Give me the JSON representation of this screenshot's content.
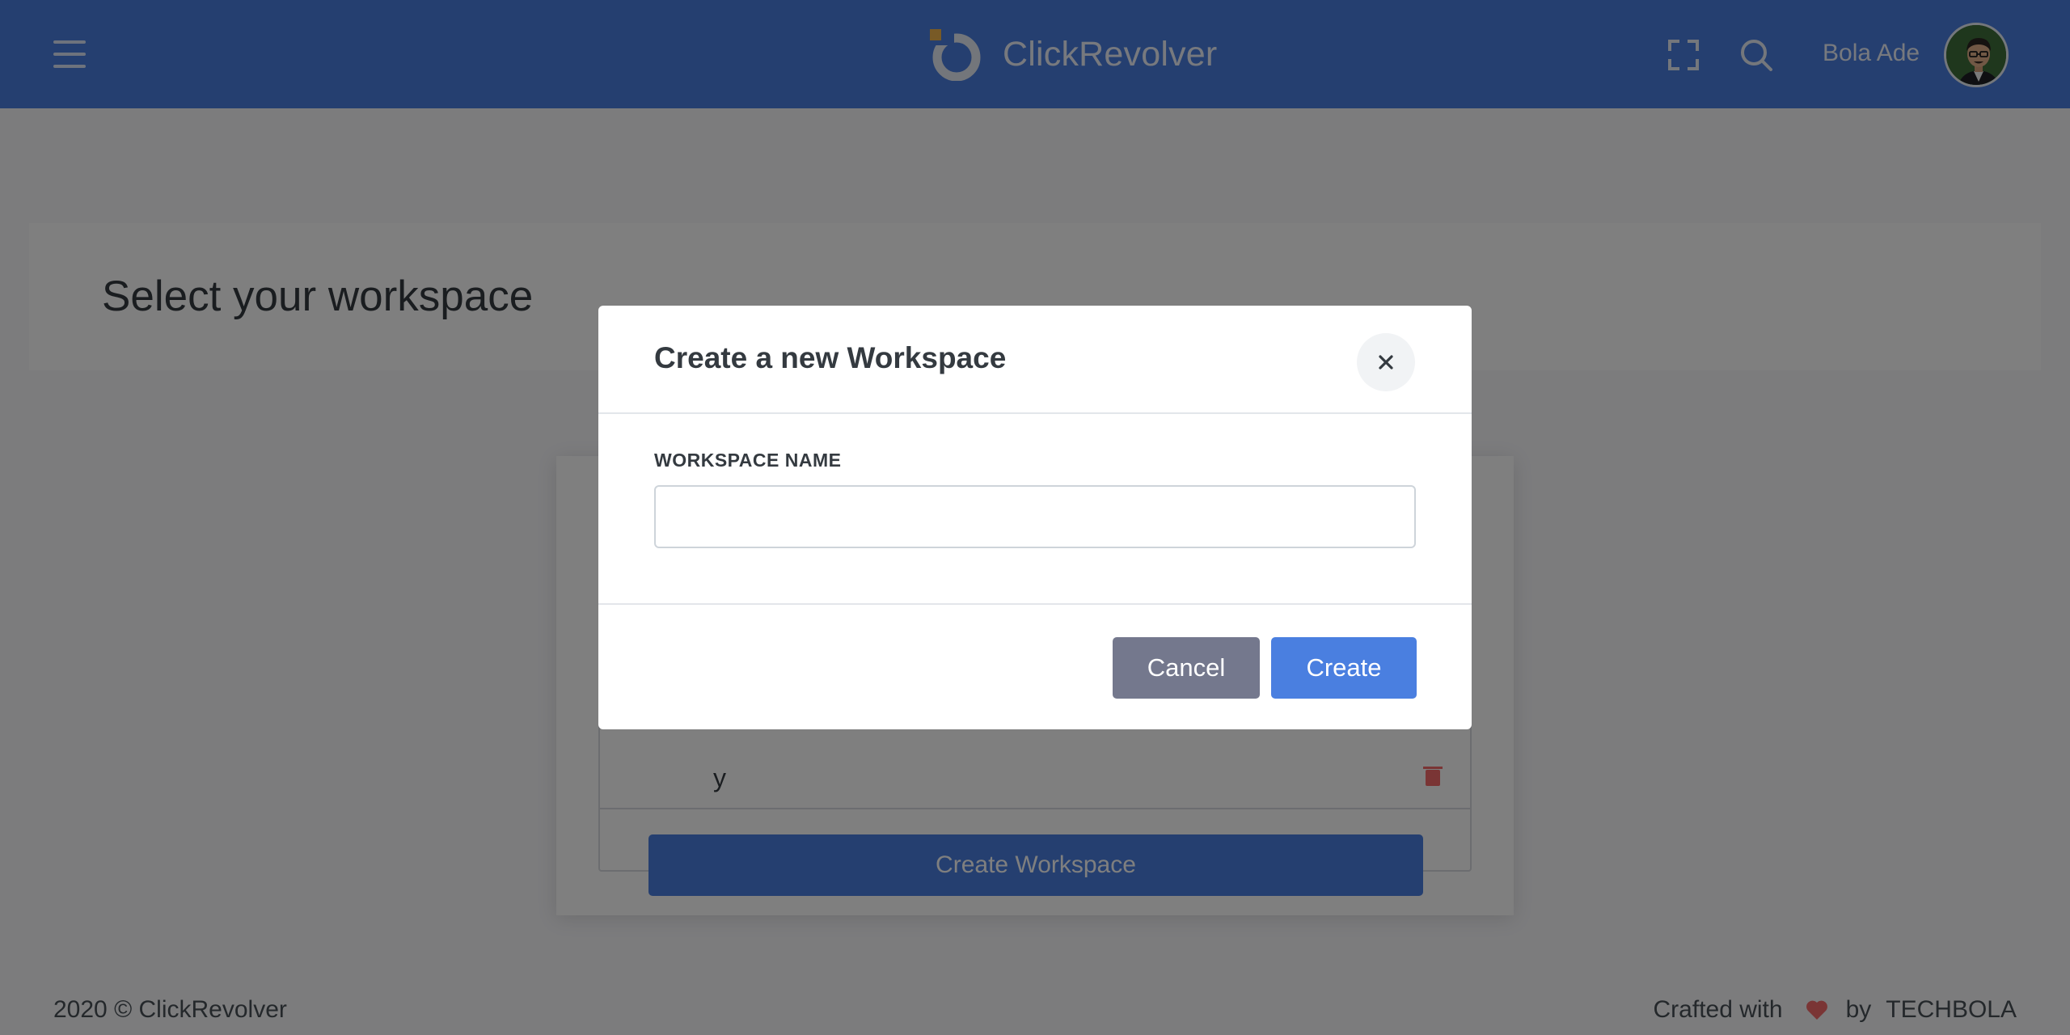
{
  "app": {
    "name": "ClickRevolver"
  },
  "header": {
    "user_name": "Bola Ade"
  },
  "page": {
    "title": "Select your workspace",
    "workspace_row_text": "y",
    "create_workspace_label": "Create Workspace"
  },
  "modal": {
    "title": "Create a new Workspace",
    "close_symbol": "×",
    "field_label": "WORKSPACE NAME",
    "field_value": "",
    "field_placeholder": "",
    "cancel_label": "Cancel",
    "create_label": "Create"
  },
  "footer": {
    "copyright": "2020 © ClickRevolver",
    "crafted_with": "Crafted with",
    "by": "by",
    "author": "TECHBOLA"
  },
  "colors": {
    "topbar": "#4a7fe0",
    "primary": "#4a7fe0",
    "secondary_button": "#74788d",
    "heart": "#f46a6a",
    "delete_icon": "#f46a6a",
    "logo_accent": "#f1b44c"
  },
  "icons": {
    "menu": "hamburger-icon",
    "fullscreen": "fullscreen-icon",
    "search": "search-icon",
    "close": "close-icon",
    "heart": "heart-icon",
    "delete": "trash-icon"
  }
}
